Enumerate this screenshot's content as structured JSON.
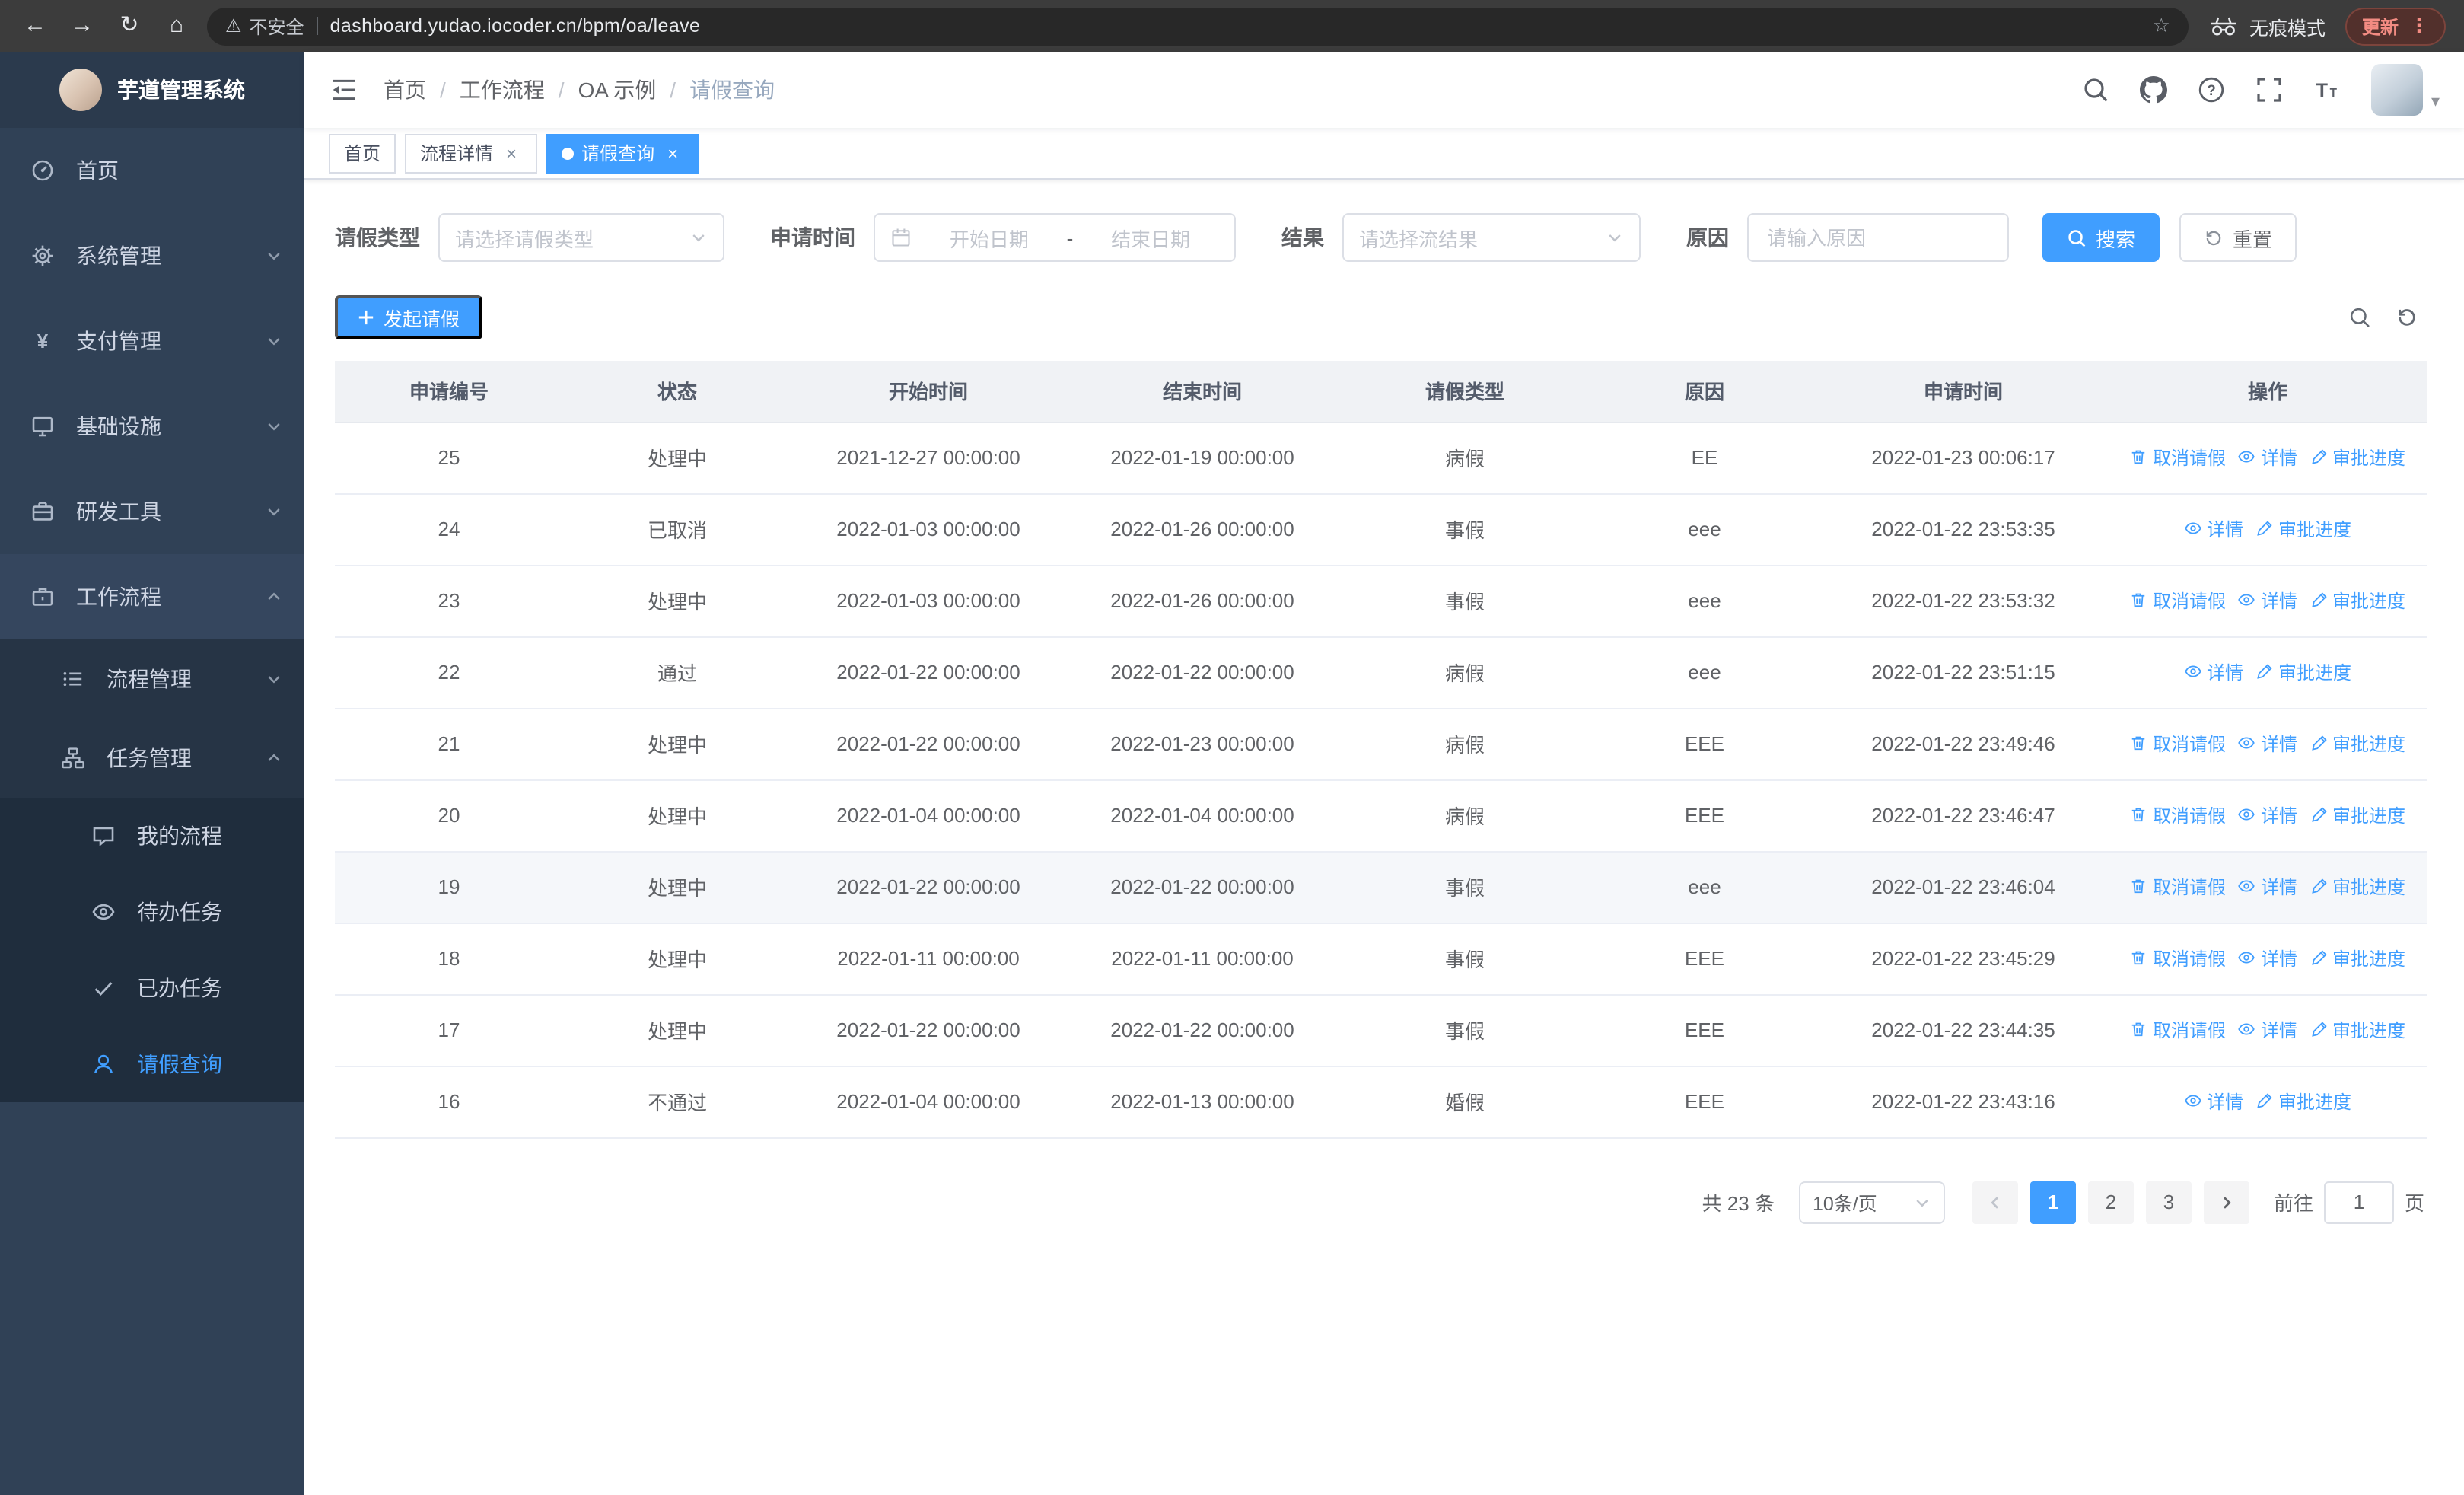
{
  "glyphs": {
    "back": "←",
    "forward": "→",
    "reload": "↻",
    "home": "⌂",
    "star": "☆",
    "warning": "⚠",
    "more": "⋮",
    "close": "×",
    "caret_down": "▾",
    "yen": "¥"
  },
  "colors": {
    "accent": "#409eff",
    "sidebar_bg": "#304156",
    "submenu_bg": "#263445",
    "update_text": "#f28b82"
  },
  "browser": {
    "security_warning": "不安全",
    "url": "dashboard.yudao.iocoder.cn/bpm/oa/leave",
    "incognito_label": "无痕模式",
    "update_label": "更新"
  },
  "sidebar": {
    "logo_title": "芋道管理系统",
    "items": [
      {
        "label": "首页",
        "icon": "dashboard-icon"
      },
      {
        "label": "系统管理",
        "icon": "gear-icon"
      },
      {
        "label": "支付管理",
        "icon": "yen-icon"
      },
      {
        "label": "基础设施",
        "icon": "monitor-icon"
      },
      {
        "label": "研发工具",
        "icon": "toolbox-icon"
      },
      {
        "label": "工作流程",
        "icon": "briefcase-icon",
        "open": true
      },
      {
        "label": "流程管理",
        "icon": "list-icon"
      },
      {
        "label": "任务管理",
        "icon": "tree-icon",
        "open": true
      },
      {
        "label": "我的流程",
        "icon": "message-icon"
      },
      {
        "label": "待办任务",
        "icon": "eye-icon"
      },
      {
        "label": "已办任务",
        "icon": "check-icon"
      },
      {
        "label": "请假查询",
        "icon": "user-icon",
        "active": true
      }
    ]
  },
  "navbar": {
    "breadcrumb": [
      "首页",
      "工作流程",
      "OA 示例",
      "请假查询"
    ],
    "separator": "/"
  },
  "tabs": [
    {
      "label": "首页",
      "closable": false,
      "active": false
    },
    {
      "label": "流程详情",
      "closable": true,
      "active": false
    },
    {
      "label": "请假查询",
      "closable": true,
      "active": true
    }
  ],
  "filters": {
    "leave_type_label": "请假类型",
    "leave_type_placeholder": "请选择请假类型",
    "apply_time_label": "申请时间",
    "start_date_placeholder": "开始日期",
    "range_separator": "-",
    "end_date_placeholder": "结束日期",
    "result_label": "结果",
    "result_placeholder": "请选择流结果",
    "reason_label": "原因",
    "reason_placeholder": "请输入原因",
    "search_label": "搜索",
    "reset_label": "重置"
  },
  "toolbar": {
    "create_label": "发起请假"
  },
  "table": {
    "columns": [
      "申请编号",
      "状态",
      "开始时间",
      "结束时间",
      "请假类型",
      "原因",
      "申请时间",
      "操作"
    ],
    "action_labels": {
      "cancel": "取消请假",
      "detail": "详情",
      "progress": "审批进度"
    },
    "rows": [
      {
        "id": "25",
        "status": "处理中",
        "start": "2021-12-27 00:00:00",
        "end": "2022-01-19 00:00:00",
        "type": "病假",
        "reason": "EE",
        "apply_time": "2022-01-23 00:06:17",
        "actions": [
          "cancel",
          "detail",
          "progress"
        ],
        "highlight": false
      },
      {
        "id": "24",
        "status": "已取消",
        "start": "2022-01-03 00:00:00",
        "end": "2022-01-26 00:00:00",
        "type": "事假",
        "reason": "eee",
        "apply_time": "2022-01-22 23:53:35",
        "actions": [
          "detail",
          "progress"
        ],
        "highlight": false
      },
      {
        "id": "23",
        "status": "处理中",
        "start": "2022-01-03 00:00:00",
        "end": "2022-01-26 00:00:00",
        "type": "事假",
        "reason": "eee",
        "apply_time": "2022-01-22 23:53:32",
        "actions": [
          "cancel",
          "detail",
          "progress"
        ],
        "highlight": false
      },
      {
        "id": "22",
        "status": "通过",
        "start": "2022-01-22 00:00:00",
        "end": "2022-01-22 00:00:00",
        "type": "病假",
        "reason": "eee",
        "apply_time": "2022-01-22 23:51:15",
        "actions": [
          "detail",
          "progress"
        ],
        "highlight": false
      },
      {
        "id": "21",
        "status": "处理中",
        "start": "2022-01-22 00:00:00",
        "end": "2022-01-23 00:00:00",
        "type": "病假",
        "reason": "EEE",
        "apply_time": "2022-01-22 23:49:46",
        "actions": [
          "cancel",
          "detail",
          "progress"
        ],
        "highlight": false
      },
      {
        "id": "20",
        "status": "处理中",
        "start": "2022-01-04 00:00:00",
        "end": "2022-01-04 00:00:00",
        "type": "病假",
        "reason": "EEE",
        "apply_time": "2022-01-22 23:46:47",
        "actions": [
          "cancel",
          "detail",
          "progress"
        ],
        "highlight": false
      },
      {
        "id": "19",
        "status": "处理中",
        "start": "2022-01-22 00:00:00",
        "end": "2022-01-22 00:00:00",
        "type": "事假",
        "reason": "eee",
        "apply_time": "2022-01-22 23:46:04",
        "actions": [
          "cancel",
          "detail",
          "progress"
        ],
        "highlight": true
      },
      {
        "id": "18",
        "status": "处理中",
        "start": "2022-01-11 00:00:00",
        "end": "2022-01-11 00:00:00",
        "type": "事假",
        "reason": "EEE",
        "apply_time": "2022-01-22 23:45:29",
        "actions": [
          "cancel",
          "detail",
          "progress"
        ],
        "highlight": false
      },
      {
        "id": "17",
        "status": "处理中",
        "start": "2022-01-22 00:00:00",
        "end": "2022-01-22 00:00:00",
        "type": "事假",
        "reason": "EEE",
        "apply_time": "2022-01-22 23:44:35",
        "actions": [
          "cancel",
          "detail",
          "progress"
        ],
        "highlight": false
      },
      {
        "id": "16",
        "status": "不通过",
        "start": "2022-01-04 00:00:00",
        "end": "2022-01-13 00:00:00",
        "type": "婚假",
        "reason": "EEE",
        "apply_time": "2022-01-22 23:43:16",
        "actions": [
          "detail",
          "progress"
        ],
        "highlight": false
      }
    ]
  },
  "pagination": {
    "total_text": "共 23 条",
    "page_size": "10条/页",
    "pages": [
      "1",
      "2",
      "3"
    ],
    "active_page": "1",
    "goto_label": "前往",
    "goto_value": "1",
    "page_unit": "页"
  }
}
